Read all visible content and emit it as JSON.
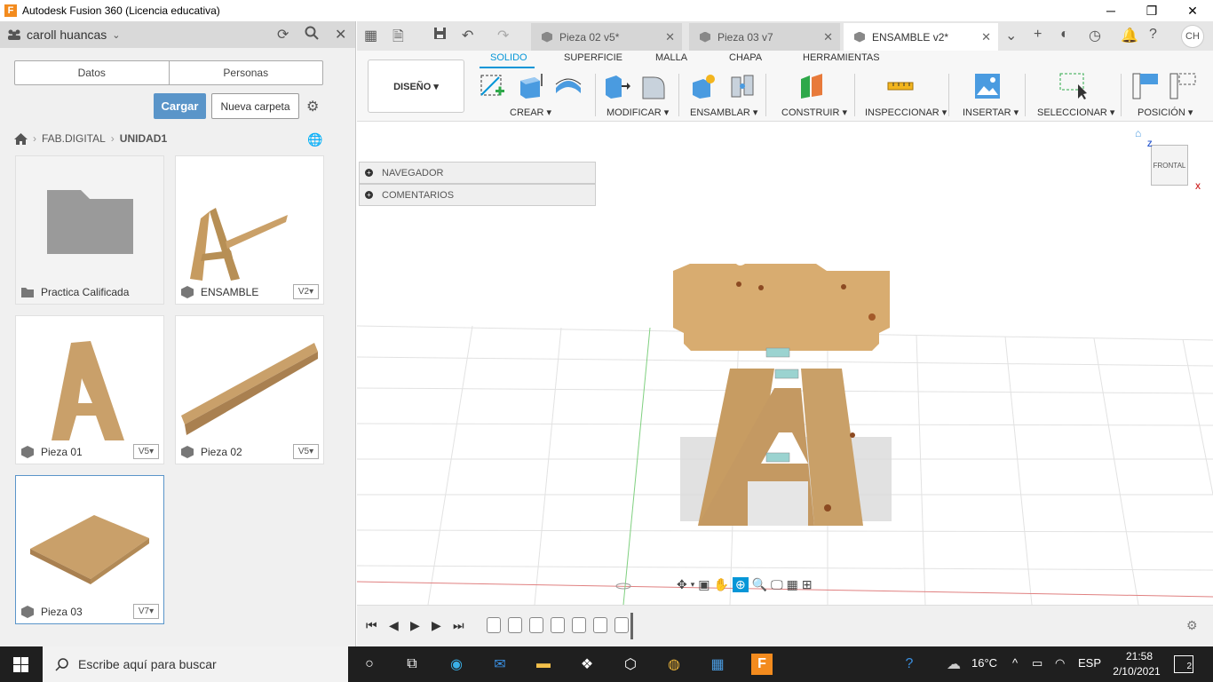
{
  "window": {
    "title": "Autodesk Fusion 360 (Licencia educativa)",
    "minimize": "─",
    "maximize": "❐",
    "close": "✕"
  },
  "left_panel": {
    "user": "caroll huancas",
    "tabs": [
      "Datos",
      "Personas"
    ],
    "upload_label": "Cargar",
    "new_folder_label": "Nueva carpeta",
    "breadcrumb": [
      "FAB.DIGITAL",
      "UNIDAD1"
    ],
    "items": [
      {
        "name": "Practica Calificada",
        "type": "folder",
        "version": ""
      },
      {
        "name": "ENSAMBLE",
        "type": "design",
        "version": "V2"
      },
      {
        "name": "Pieza 01",
        "type": "design",
        "version": "V5"
      },
      {
        "name": "Pieza 02",
        "type": "design",
        "version": "V5"
      },
      {
        "name": "Pieza 03",
        "type": "design",
        "version": "V7"
      }
    ]
  },
  "tabs": {
    "documents": [
      {
        "label": "Pieza 02 v5*"
      },
      {
        "label": "Pieza 03 v7"
      },
      {
        "label": "ENSAMBLE v2*"
      }
    ],
    "user_initials": "CH"
  },
  "toolbar": {
    "workspace": "DISEÑO ▾",
    "tabs": [
      "SOLIDO",
      "SUPERFICIE",
      "MALLA",
      "CHAPA",
      "HERRAMIENTAS"
    ],
    "groups": [
      "CREAR ▾",
      "MODIFICAR ▾",
      "ENSAMBLAR ▾",
      "CONSTRUIR ▾",
      "INSPECCIONAR ▾",
      "INSERTAR ▾",
      "SELECCIONAR ▾",
      "POSICIÓN ▾"
    ]
  },
  "viewport": {
    "browser_items": [
      "NAVEGADOR",
      "COMENTARIOS"
    ],
    "viewcube_label": "FRONTAL",
    "axis_z": "Z",
    "axis_x": "X"
  },
  "taskbar": {
    "search_placeholder": "Escribe aquí para buscar",
    "weather": "16°C",
    "lang": "ESP",
    "time": "21:58",
    "date": "2/10/2021",
    "notifications": "2"
  }
}
